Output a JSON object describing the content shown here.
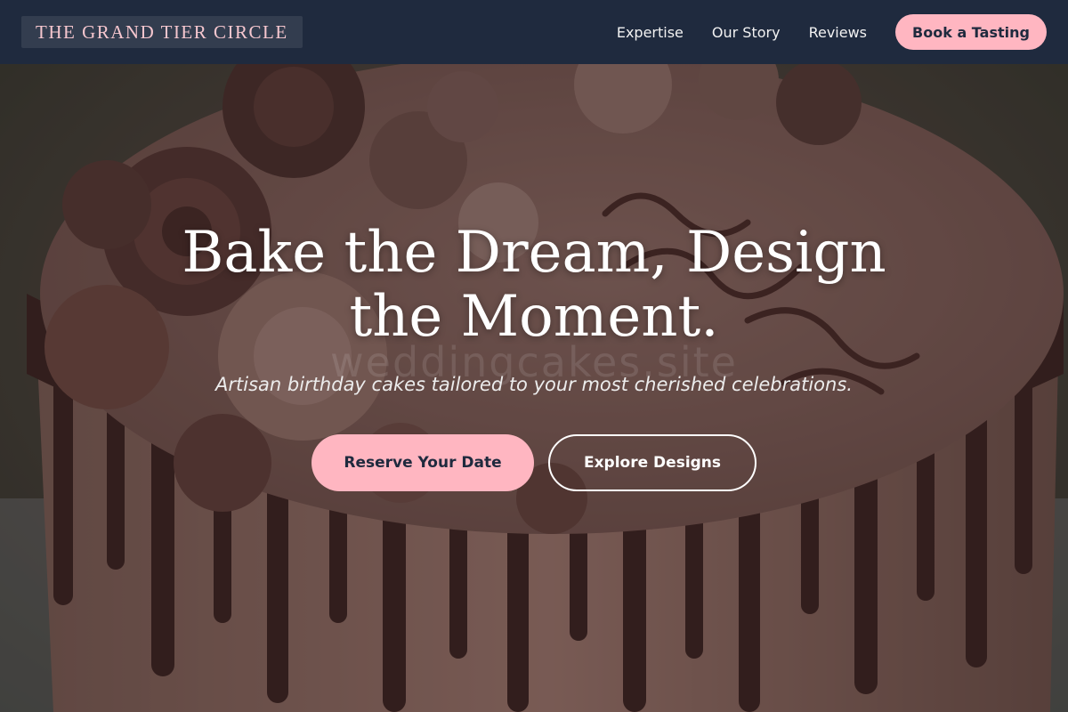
{
  "header": {
    "brand": "THE GRAND TIER CIRCLE",
    "nav": [
      {
        "label": "Expertise"
      },
      {
        "label": "Our Story"
      },
      {
        "label": "Reviews"
      }
    ],
    "cta_label": "Book a Tasting"
  },
  "hero": {
    "title": "Bake the Dream, Design the Moment.",
    "subtitle": "Artisan birthday cakes tailored to your most cherished celebrations.",
    "watermark": "weddingcakes.site",
    "primary_button": "Reserve Your Date",
    "secondary_button": "Explore Designs"
  },
  "colors": {
    "navbar": "#1f2a3e",
    "accent_pink": "#ffb6c1",
    "brand_text": "#f6c7cf",
    "text_light": "#ffffff"
  },
  "icons": {
    "hero_image": "chocolate-birthday-cake-photo"
  }
}
